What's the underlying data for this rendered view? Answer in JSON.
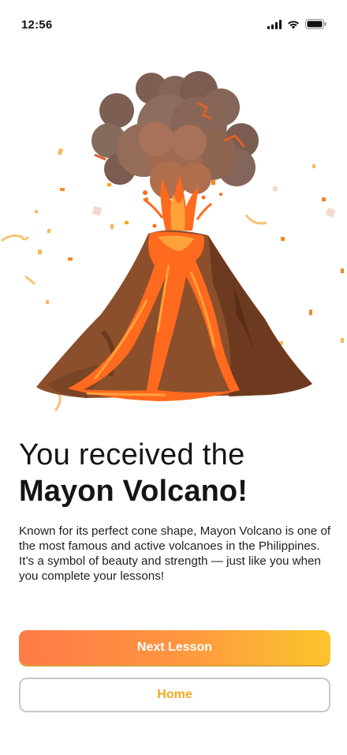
{
  "status_bar": {
    "time": "12:56",
    "icons": [
      "signal-icon",
      "wifi-icon",
      "battery-icon"
    ]
  },
  "illustration": {
    "subject": "volcano-eruption",
    "colors": {
      "smoke_dark": "#7a5d50",
      "smoke_light": "#9c7a6a",
      "mountain": "#8c4f2c",
      "mountain_shadow": "#6e3a1f",
      "lava": "#ff6a1f",
      "lava_light": "#ffa23a",
      "confetti": "#f5a623"
    }
  },
  "reward": {
    "title_line1": "You received the",
    "title_line2": "Mayon Volcano!",
    "description_p1": "Known for its perfect cone shape, Mayon Volcano is one of the most famous and active volcanoes in the Philippines.",
    "description_p2": "It’s a symbol of beauty and strength — just like you when you complete your lessons!"
  },
  "actions": {
    "next_label": "Next Lesson",
    "home_label": "Home"
  },
  "colors": {
    "primary_gradient_start": "#ff7a47",
    "primary_gradient_end": "#fbc52d",
    "secondary_text": "#f0a91e"
  }
}
